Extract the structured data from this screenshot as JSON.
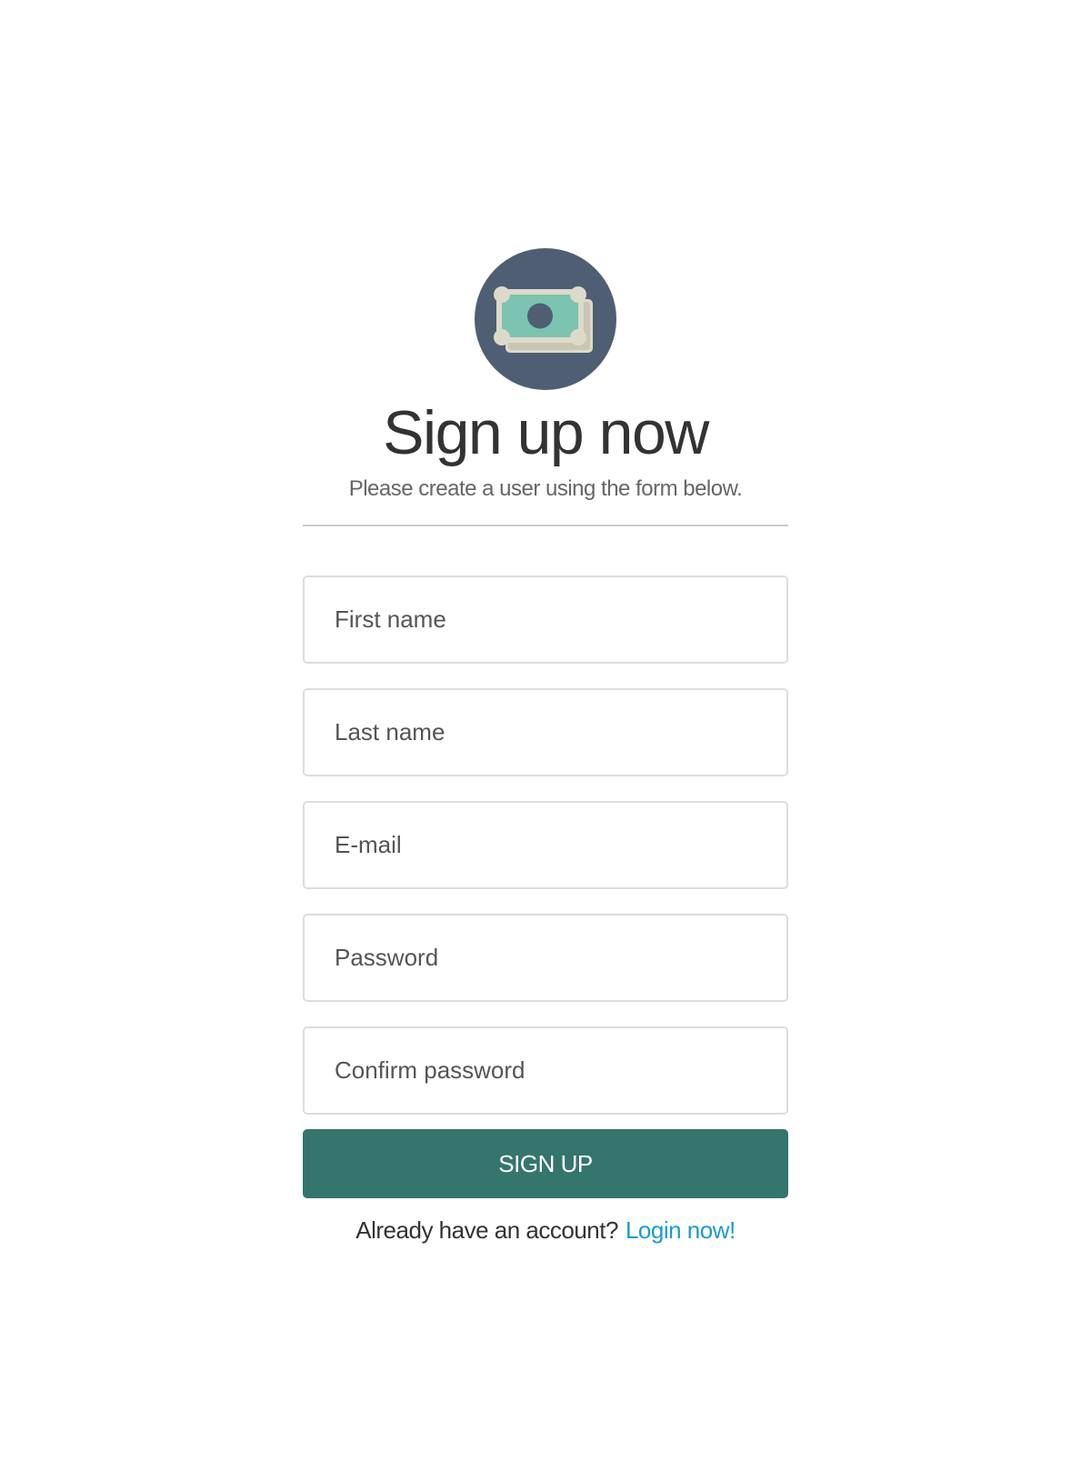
{
  "header": {
    "logo_icon": "money-bills-icon",
    "title": "Sign up now",
    "subtitle": "Please create a user using the form below."
  },
  "form": {
    "first_name": {
      "placeholder": "First name",
      "value": ""
    },
    "last_name": {
      "placeholder": "Last name",
      "value": ""
    },
    "email": {
      "placeholder": "E-mail",
      "value": ""
    },
    "password": {
      "placeholder": "Password",
      "value": ""
    },
    "confirm_password": {
      "placeholder": "Confirm password",
      "value": ""
    },
    "submit_label": "SIGN UP"
  },
  "footer": {
    "prompt": "Already have an account?",
    "link_label": "Login now!"
  },
  "colors": {
    "logo_circle": "#4f5e73",
    "bill_green": "#7cc4af",
    "bill_cream": "#dcdac8",
    "button": "#34756d",
    "link": "#1a9ad6"
  }
}
